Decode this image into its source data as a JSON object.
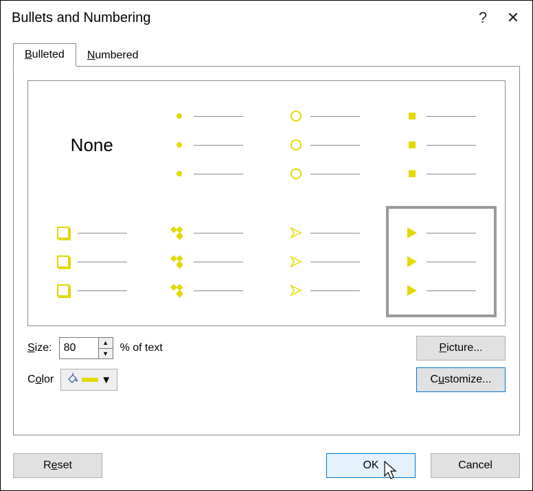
{
  "title": "Bullets and Numbering",
  "help_glyph": "?",
  "close_glyph": "✕",
  "tabs": {
    "bulleted": "Bulleted",
    "numbered": "Numbered",
    "active": "bulleted"
  },
  "grid": {
    "none_label": "None",
    "cells": [
      {
        "id": "none",
        "type": "none",
        "selected": false
      },
      {
        "id": "filled-dot",
        "type": "dot",
        "selected": false
      },
      {
        "id": "hollow-ring",
        "type": "ring",
        "selected": false
      },
      {
        "id": "filled-square",
        "type": "sq",
        "selected": false
      },
      {
        "id": "hollow-square",
        "type": "osq",
        "selected": false
      },
      {
        "id": "four-diamonds",
        "type": "diamond4",
        "selected": false
      },
      {
        "id": "arrow-outline",
        "type": "arrowo",
        "selected": false
      },
      {
        "id": "arrow-filled",
        "type": "arrowr",
        "selected": true
      }
    ],
    "accent_color": "#e2d900"
  },
  "size": {
    "label": "Size:",
    "value": "80",
    "suffix": "% of text"
  },
  "color": {
    "label": "Color",
    "value": "#e2d900"
  },
  "buttons": {
    "picture": "Picture...",
    "customize": "Customize...",
    "reset": "Reset",
    "ok": "OK",
    "cancel": "Cancel"
  }
}
